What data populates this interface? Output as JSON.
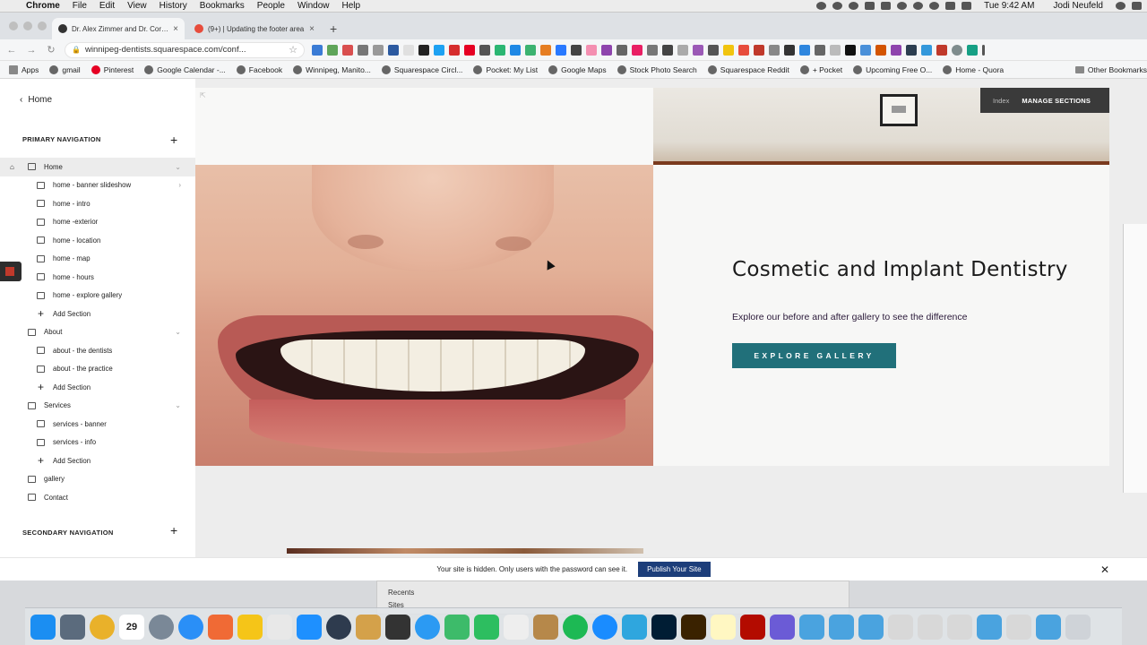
{
  "menubar": {
    "app": "Chrome",
    "items": [
      "File",
      "Edit",
      "View",
      "History",
      "Bookmarks",
      "People",
      "Window",
      "Help"
    ],
    "clock": "Tue 9:42 AM",
    "user": "Jodi Neufeld"
  },
  "browser": {
    "tabs": [
      {
        "title": "Dr. Alex Zimmer and Dr. Cory P",
        "active": true
      },
      {
        "title": "(9+) | Updating the footer area",
        "active": false
      }
    ],
    "url": "winnipeg-dentists.squarespace.com/conf...",
    "bookmarks": [
      "Apps",
      "gmail",
      "Pinterest",
      "Google Calendar -...",
      "Facebook",
      "Winnipeg, Manito...",
      "Squarespace Circl...",
      "Pocket: My List",
      "Google Maps",
      "Stock Photo Search",
      "Squarespace Reddit",
      "+ Pocket",
      "Upcoming Free O...",
      "Home - Quora"
    ],
    "other_bookmarks": "Other Bookmarks"
  },
  "sidebar": {
    "back_label": "Home",
    "primary_heading": "PRIMARY NAVIGATION",
    "secondary_heading": "SECONDARY NAVIGATION",
    "secondary_cut_text": "....... ........ ...........",
    "items": [
      {
        "label": "Home",
        "level": "top"
      },
      {
        "label": "home - banner slideshow",
        "level": "sub"
      },
      {
        "label": "home - intro",
        "level": "sub"
      },
      {
        "label": "home -exterior",
        "level": "sub"
      },
      {
        "label": "home - location",
        "level": "sub"
      },
      {
        "label": "home - map",
        "level": "sub"
      },
      {
        "label": "home - hours",
        "level": "sub"
      },
      {
        "label": "home - explore gallery",
        "level": "sub"
      },
      {
        "label": "Add Section",
        "level": "add"
      },
      {
        "label": "About",
        "level": "top"
      },
      {
        "label": "about - the dentists",
        "level": "sub"
      },
      {
        "label": "about - the practice",
        "level": "sub"
      },
      {
        "label": "Add Section",
        "level": "add"
      },
      {
        "label": "Services",
        "level": "top"
      },
      {
        "label": "services - banner",
        "level": "sub"
      },
      {
        "label": "services - info",
        "level": "sub"
      },
      {
        "label": "Add Section",
        "level": "add"
      },
      {
        "label": "gallery",
        "level": "top"
      },
      {
        "label": "Contact",
        "level": "top"
      }
    ]
  },
  "editor": {
    "index_label": "Index",
    "manage_label": "MANAGE SECTIONS"
  },
  "section": {
    "title": "Cosmetic and Implant Dentistry",
    "subtitle": "Explore our before and after gallery to see the difference",
    "button": "EXPLORE GALLERY"
  },
  "notice": {
    "text": "Your site is hidden. Only users with the password can see it.",
    "button": "Publish Your Site"
  },
  "finder": {
    "recents": "Recents",
    "sites": "Sites"
  },
  "dock": {
    "calendar_day": "29"
  },
  "colors": {
    "button": "#21707a",
    "publish": "#1d3e7a"
  }
}
